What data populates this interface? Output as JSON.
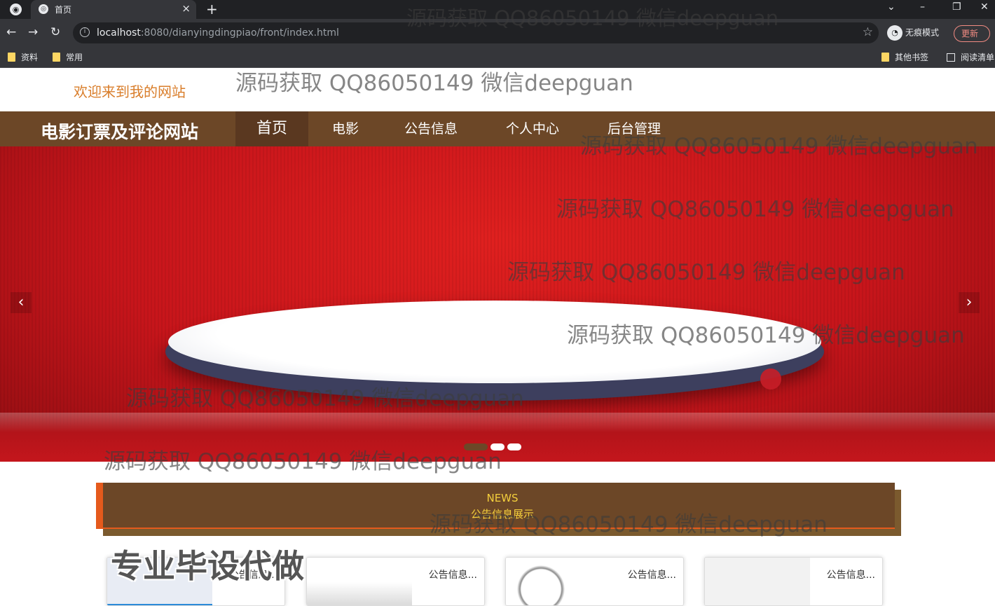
{
  "browser": {
    "tab_title": "首页",
    "tab_close": "×",
    "new_tab": "+",
    "url_host": "localhost",
    "url_rest": ":8080/dianyingdingpiao/front/index.html",
    "incognito_label": "无痕模式",
    "update_label": "更新",
    "bookmarks": [
      "资料",
      "常用"
    ],
    "other_bookmarks": "其他书签",
    "reading_list": "阅读清单"
  },
  "header": {
    "welcome": "欢迎来到我的网站",
    "site_title": "电影订票及评论网站",
    "nav": [
      "首页",
      "电影",
      "公告信息",
      "个人中心",
      "后台管理"
    ]
  },
  "banner": {
    "prev_arrow": "‹",
    "next_arrow": "›",
    "slides_total": 3,
    "active_slide": 1
  },
  "news": {
    "label_en": "NEWS",
    "label_cn": "公告信息展示"
  },
  "cards": [
    "公告信息...",
    "公告信息...",
    "公告信息...",
    "公告信息..."
  ],
  "overlay": {
    "watermark": "源码获取 QQ86050149 微信deepguan",
    "ad_text": "专业毕设代做"
  },
  "colors": {
    "nav_bg": "#6c4727",
    "accent": "#e55a1c",
    "news_text": "#f4cf3c",
    "welcome": "#d97d2a",
    "banner_red": "#c7151b"
  }
}
